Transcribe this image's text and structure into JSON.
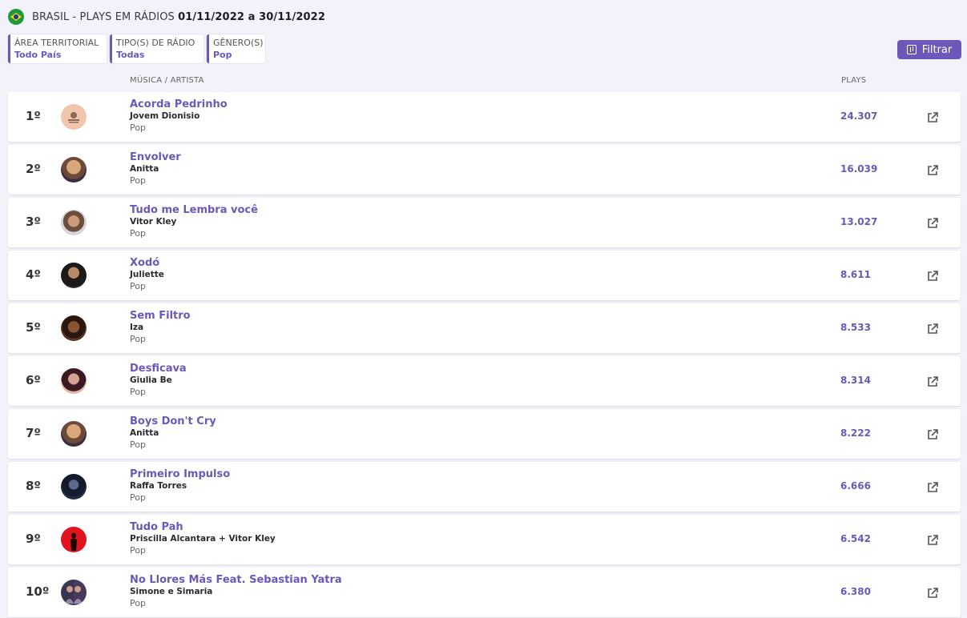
{
  "header": {
    "title_prefix": "BRASIL - PLAYS EM RÁDIOS",
    "date_range": "01/11/2022 a 30/11/2022"
  },
  "filters": [
    {
      "label": "ÁREA TERRITORIAL",
      "value": "Todo País"
    },
    {
      "label": "TIPO(S) DE RÁDIO",
      "value": "Todas"
    },
    {
      "label": "GÊNERO(S)",
      "value": "Pop"
    }
  ],
  "filter_button": {
    "label": "Filtrar"
  },
  "columns": {
    "music": "MÚSICA / ARTISTA",
    "plays": "PLAYS"
  },
  "colors": {
    "accent": "#6b58b8",
    "background": "#f3f2fb"
  },
  "rows": [
    {
      "rank": "1º",
      "song": "Acorda Pedrinho",
      "artist": "Jovem Dionisio",
      "genre": "Pop",
      "plays": "24.307"
    },
    {
      "rank": "2º",
      "song": "Envolver",
      "artist": "Anitta",
      "genre": "Pop",
      "plays": "16.039"
    },
    {
      "rank": "3º",
      "song": "Tudo me Lembra você",
      "artist": "Vitor Kley",
      "genre": "Pop",
      "plays": "13.027"
    },
    {
      "rank": "4º",
      "song": "Xodó",
      "artist": "Juliette",
      "genre": "Pop",
      "plays": "8.611"
    },
    {
      "rank": "5º",
      "song": "Sem Filtro",
      "artist": "Iza",
      "genre": "Pop",
      "plays": "8.533"
    },
    {
      "rank": "6º",
      "song": "Desficava",
      "artist": "Giulia Be",
      "genre": "Pop",
      "plays": "8.314"
    },
    {
      "rank": "7º",
      "song": "Boys Don't Cry",
      "artist": "Anitta",
      "genre": "Pop",
      "plays": "8.222"
    },
    {
      "rank": "8º",
      "song": "Primeiro Impulso",
      "artist": "Raffa Torres",
      "genre": "Pop",
      "plays": "6.666"
    },
    {
      "rank": "9º",
      "song": "Tudo Pah",
      "artist": "Priscilla Alcantara + Vitor Kley",
      "genre": "Pop",
      "plays": "6.542"
    },
    {
      "rank": "10º",
      "song": "No Llores Más Feat. Sebastian Yatra",
      "artist": "Simone e Simaria",
      "genre": "Pop",
      "plays": "6.380"
    }
  ]
}
